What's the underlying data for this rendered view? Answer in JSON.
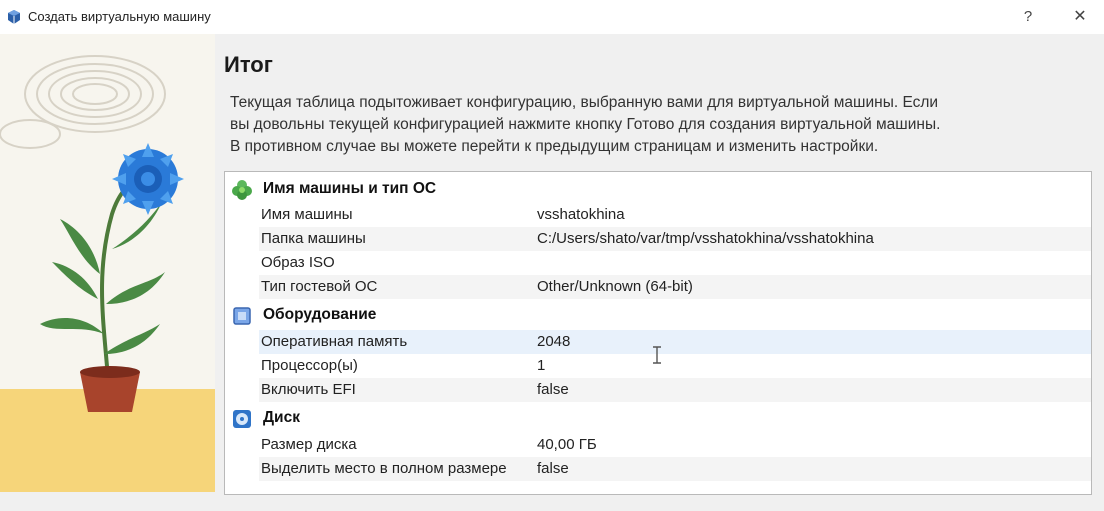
{
  "window": {
    "title": "Создать виртуальную машину",
    "help_label": "?",
    "close_label": "✕"
  },
  "page": {
    "heading": "Итог",
    "description_lines": [
      "Текущая таблица подытоживает конфигурацию, выбранную вами для виртуальной машины. Если",
      "вы довольны текущей конфигурацией нажмите кнопку Готово для создания виртуальной машины.",
      "В противном случае вы можете перейти к предыдущим страницам и изменить настройки."
    ]
  },
  "summary": {
    "sections": [
      {
        "title": "Имя машины и тип ОС",
        "icon": "puzzle-icon",
        "rows": [
          {
            "key": "Имя машины",
            "value": "vsshatokhina"
          },
          {
            "key": "Папка машины",
            "value": "C:/Users/shato/var/tmp/vsshatokhina/vsshatokhina"
          },
          {
            "key": "Образ ISO",
            "value": ""
          },
          {
            "key": "Тип гостевой ОС",
            "value": "Other/Unknown (64-bit)"
          }
        ]
      },
      {
        "title": "Оборудование",
        "icon": "chip-icon",
        "rows": [
          {
            "key": "Оперативная память",
            "value": "2048"
          },
          {
            "key": "Процессор(ы)",
            "value": "1"
          },
          {
            "key": "Включить EFI",
            "value": "false"
          }
        ]
      },
      {
        "title": "Диск",
        "icon": "disk-icon",
        "rows": [
          {
            "key": "Размер диска",
            "value": "40,00 ГБ"
          },
          {
            "key": "Выделить место в полном размере",
            "value": "false"
          }
        ]
      }
    ]
  },
  "colors": {
    "accent_blue": "#1e6fd0",
    "sidebar_yellow": "#f6d57a",
    "row_highlight": "#e8f1fb"
  }
}
